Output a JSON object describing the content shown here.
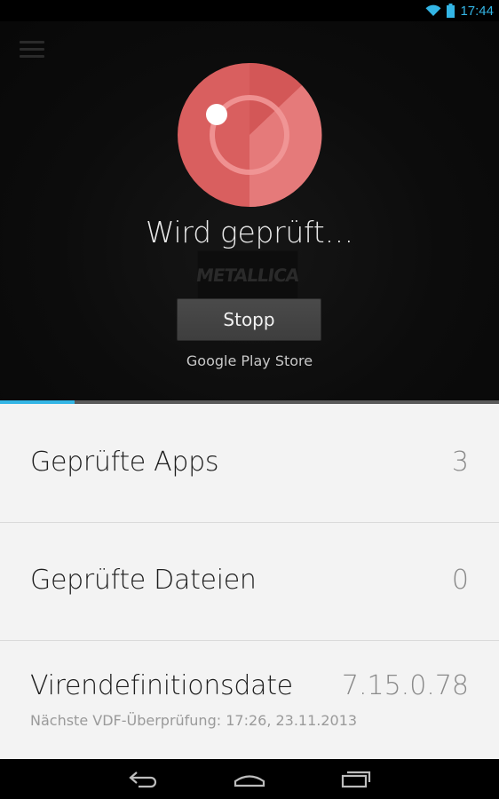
{
  "status_bar": {
    "time": "17:44",
    "icons": [
      "wifi-icon",
      "battery-icon"
    ],
    "color": "#33b5e5"
  },
  "hero": {
    "menu_icon": "menu-icon",
    "scan_icon": "scan-radar-icon",
    "status_title": "Wird geprüft…",
    "stop_label": "Stopp",
    "current_app": "Google Play Store",
    "accent": "#e06666"
  },
  "progress": {
    "fraction": 0.15,
    "color": "#33b5e5"
  },
  "stats": [
    {
      "label": "Geprüfte Apps",
      "value": "3"
    },
    {
      "label": "Geprüfte Dateien",
      "value": "0"
    },
    {
      "label": "Virendefinitionsdate",
      "value": "7.15.0.78",
      "sub": "Nächste VDF-Überprüfung: 17:26, 23.11.2013"
    }
  ],
  "nav_bar": {
    "buttons": [
      "back-icon",
      "home-icon",
      "recent-apps-icon"
    ]
  }
}
